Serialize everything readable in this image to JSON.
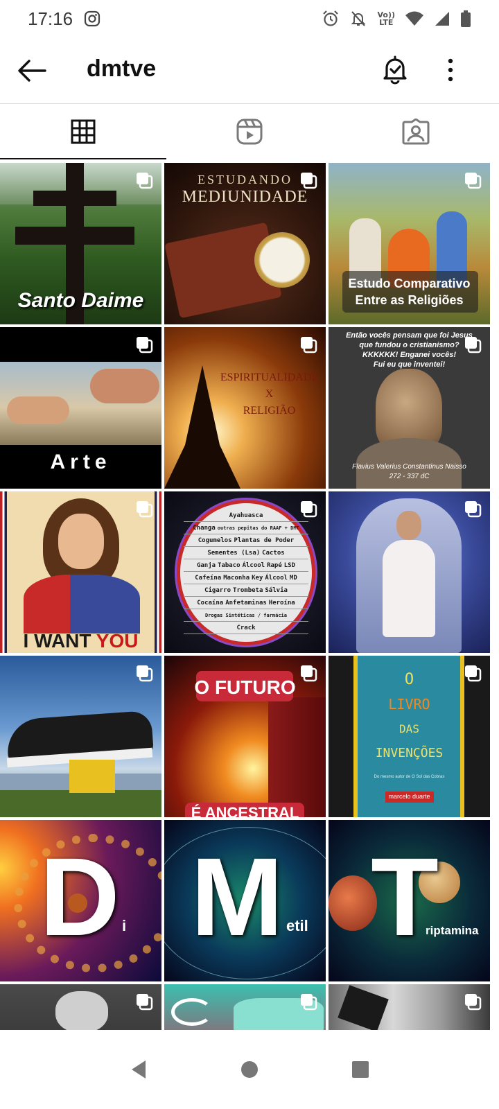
{
  "status_bar": {
    "time": "17:16",
    "volte_top": "Vo))",
    "volte_bottom": "LTE",
    "icons": [
      "instagram-icon",
      "alarm-icon",
      "notifications-off-icon",
      "volte-icon",
      "wifi-icon",
      "signal-icon",
      "battery-icon"
    ]
  },
  "header": {
    "title": "dmtve",
    "icons": [
      "back-arrow-icon",
      "bell-check-icon",
      "more-vertical-icon"
    ]
  },
  "tabs": [
    {
      "name": "grid",
      "icon": "grid-icon",
      "active": true
    },
    {
      "name": "reels",
      "icon": "reels-icon",
      "active": false
    },
    {
      "name": "tagged",
      "icon": "tagged-icon",
      "active": false
    }
  ],
  "posts": {
    "p1": {
      "text": "Santo Daime"
    },
    "p2": {
      "line1": "ESTUDANDO",
      "line2": "MEDIUNIDADE"
    },
    "p3": {
      "line1": "Estudo Comparativo",
      "line2": "Entre as Religiões"
    },
    "p4": {
      "text": "Arte"
    },
    "p5": {
      "line1": "ESPIRITUALIDADE",
      "line2": "X",
      "line3": "RELIGIÃO"
    },
    "p6": {
      "quote1": "Então vocês pensam que foi Jesus",
      "quote2": "que fundou o cristianismo?",
      "quote3": "KKKKKK! Enganei vocês!",
      "quote4": "Fui eu que inventei!",
      "caption1": "Flavius Valerius Constantinus Naisso",
      "caption2": "272 - 337 dC"
    },
    "p7": {
      "text1": "I WANT ",
      "text2": "YOU"
    },
    "p8": {
      "rows": [
        [
          "Ayahuasca"
        ],
        [
          "Changa",
          "outras pepitas do RAAF + DMT"
        ],
        [
          "Cogumelos",
          "Plantas de Poder"
        ],
        [
          "Sementes (Lsa)",
          "Cactos"
        ],
        [
          "Ganja",
          "Tabaco",
          "Álcool",
          "Rapé",
          "LSD"
        ],
        [
          "Cafeína",
          "Maconha",
          "Key",
          "Álcool",
          "MD"
        ],
        [
          "Cigarro",
          "Trombeta",
          "Sálvia"
        ],
        [
          "Cocaína",
          "Anfetaminas",
          "Heroína"
        ],
        [
          "Drogas Sintéticas / farmácia"
        ],
        [
          "Crack"
        ]
      ]
    },
    "p9": {},
    "p10": {},
    "p11": {
      "line1": "O FUTURO",
      "line2": "É ANCESTRAL"
    },
    "p12": {
      "line1": "O",
      "line2": "LIVRO",
      "line3": "DAS",
      "line4": "INVENÇÕES",
      "sub": "Do mesmo autor de O Sol das Cobras",
      "author": "marcelo duarte"
    },
    "p13": {
      "big": "D",
      "small": "i"
    },
    "p14": {
      "big": "M",
      "small": "etil"
    },
    "p15": {
      "big": "T",
      "small": "riptamina"
    },
    "p16": {},
    "p17": {},
    "p18": {}
  },
  "multi_post_icon": "multiple-photos-icon",
  "nav_bar": {
    "icons": [
      "back-triangle-icon",
      "home-circle-icon",
      "recents-square-icon"
    ]
  }
}
